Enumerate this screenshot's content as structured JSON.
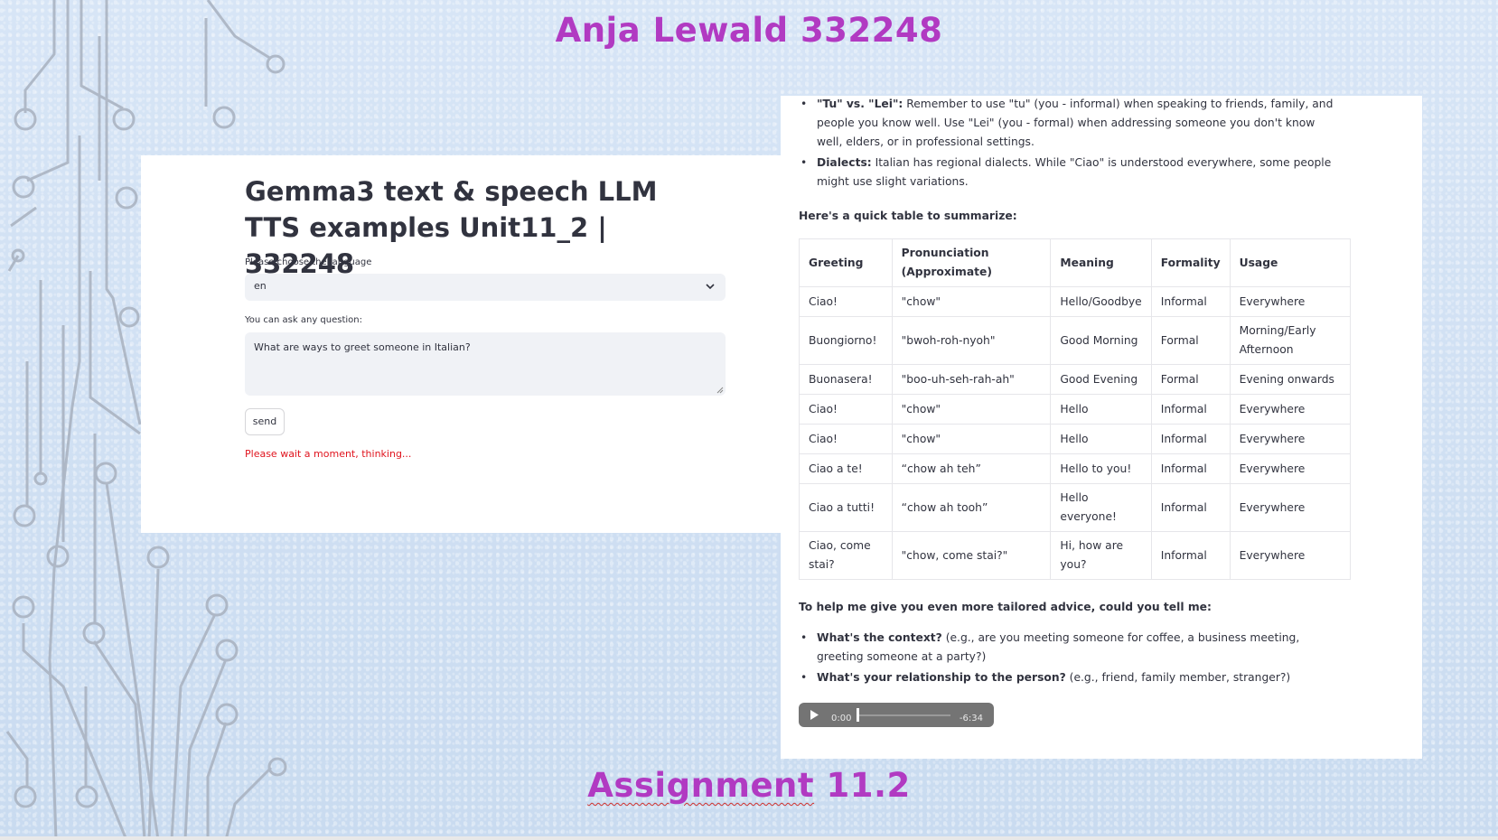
{
  "slide": {
    "title": "Anja Lewald 332248",
    "footer_word": "Assignment",
    "footer_number": " 11.2"
  },
  "app": {
    "title": "Gemma3 text & speech LLM TTS examples Unit11_2 | 332248",
    "language_label": "Please choose the language",
    "language_value": "en",
    "question_label": "You can ask any question:",
    "question_value": "What are ways to greet someone in Italian?",
    "send_label": "send",
    "status_text": "Please wait a moment, thinking..."
  },
  "response": {
    "top_bullets": [
      {
        "bold": "\"Tu\" vs. \"Lei\":",
        "text": " Remember to use \"tu\" (you - informal) when speaking to friends, family, and people you know well. Use \"Lei\" (you - formal) when addressing someone you don't know well, elders, or in professional settings."
      },
      {
        "bold": "Dialects:",
        "text": " Italian has regional dialects. While \"Ciao\" is understood everywhere, some people might use slight variations."
      }
    ],
    "table_intro": "Here's a quick table to summarize:",
    "table_headers": [
      "Greeting",
      "Pronunciation (Approximate)",
      "Meaning",
      "Formality",
      "Usage"
    ],
    "table_rows": [
      [
        "Ciao!",
        "\"chow\"",
        "Hello/Goodbye",
        "Informal",
        "Everywhere"
      ],
      [
        "Buongiorno!",
        "\"bwoh-roh-nyoh\"",
        "Good Morning",
        "Formal",
        "Morning/Early Afternoon"
      ],
      [
        "Buonasera!",
        "\"boo-uh-seh-rah-ah\"",
        "Good Evening",
        "Formal",
        "Evening onwards"
      ],
      [
        "Ciao!",
        "\"chow\"",
        "Hello",
        "Informal",
        "Everywhere"
      ],
      [
        "Ciao!",
        "\"chow\"",
        "Hello",
        "Informal",
        "Everywhere"
      ],
      [
        "Ciao a te!",
        "“chow ah teh”",
        "Hello to you!",
        "Informal",
        "Everywhere"
      ],
      [
        "Ciao a tutti!",
        "“chow ah tooh”",
        "Hello everyone!",
        "Informal",
        "Everywhere"
      ],
      [
        "Ciao, come stai?",
        "\"chow, come stai?\"",
        "Hi, how are you?",
        "Informal",
        "Everywhere"
      ]
    ],
    "advice_intro": "To help me give you even more tailored advice, could you tell me:",
    "bottom_bullets": [
      {
        "bold": "What's the context?",
        "text": " (e.g., are you meeting someone for coffee, a business meeting, greeting someone at a party?)"
      },
      {
        "bold": "What's your relationship to the person?",
        "text": " (e.g., friend, family member, stranger?)"
      }
    ],
    "audio": {
      "current": "0:00",
      "remaining": "-6:34",
      "progress": 0.0
    }
  },
  "colors": {
    "accent": "#b13ac2",
    "error": "#e0141e",
    "background": "#cfdff2"
  }
}
